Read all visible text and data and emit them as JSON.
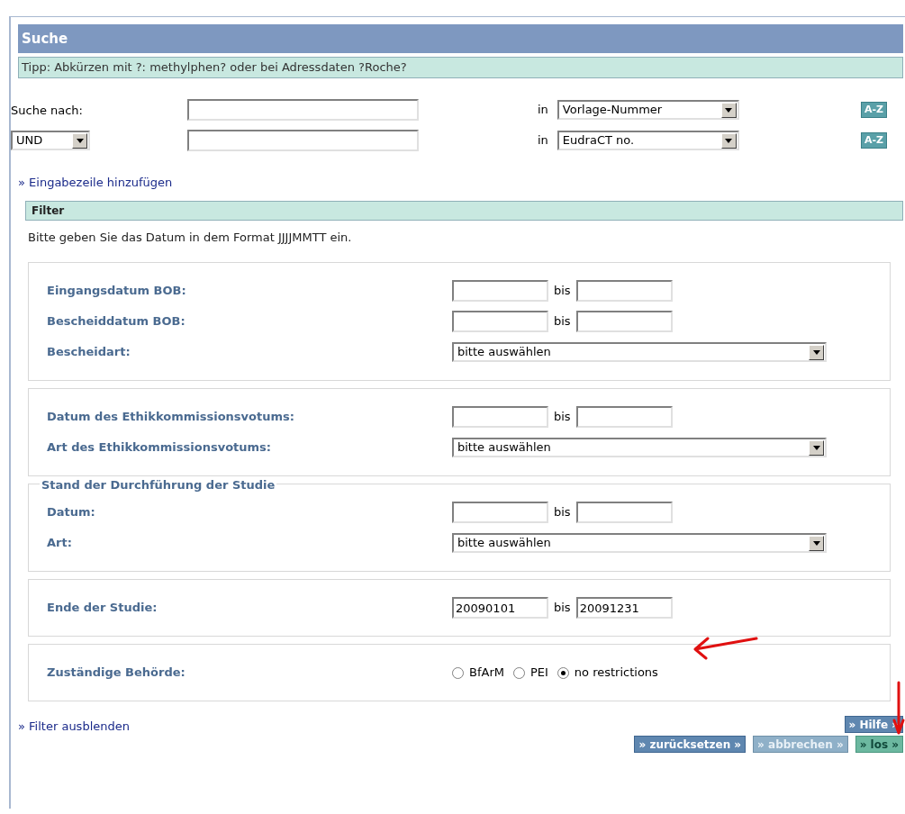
{
  "title": "Suche",
  "tip": "Tipp: Abkürzen mit ?: methylphen? oder bei Adressdaten ?Roche?",
  "search_rows": [
    {
      "kind": "label",
      "label": "Suche nach:",
      "value": "",
      "in": "in",
      "field": "Vorlage-Nummer",
      "az": "A-Z"
    },
    {
      "kind": "operator",
      "label": "UND",
      "value": "",
      "in": "in",
      "field": "EudraCT no.",
      "az": "A-Z"
    }
  ],
  "add_row_link": "» Eingabezeile hinzufügen",
  "filter": {
    "title": "Filter",
    "hint": "Bitte geben Sie das Datum in dem Format JJJJMMTT ein.",
    "groups": [
      {
        "rows": [
          {
            "kind": "range",
            "label": "Eingangsdatum BOB:",
            "from": "",
            "bis": "bis",
            "to": ""
          },
          {
            "kind": "range",
            "label": "Bescheiddatum BOB:",
            "from": "",
            "bis": "bis",
            "to": ""
          },
          {
            "kind": "select",
            "label": "Bescheidart:",
            "value": "bitte auswählen"
          }
        ]
      },
      {
        "rows": [
          {
            "kind": "range",
            "label": "Datum des Ethikkommissionsvotums:",
            "from": "",
            "bis": "bis",
            "to": ""
          },
          {
            "kind": "select",
            "label": "Art des Ethikkommissionsvotums:",
            "value": "bitte auswählen"
          }
        ]
      },
      {
        "legend": "Stand der Durchführung der Studie",
        "rows": [
          {
            "kind": "range",
            "label": "Datum:",
            "from": "",
            "bis": "bis",
            "to": ""
          },
          {
            "kind": "select",
            "label": "Art:",
            "value": "bitte auswählen"
          }
        ]
      },
      {
        "rows": [
          {
            "kind": "range",
            "label": "Ende der Studie:",
            "from": "20090101",
            "bis": "bis",
            "to": "20091231"
          }
        ]
      },
      {
        "rows": [
          {
            "kind": "radio",
            "label": "Zuständige Behörde:",
            "options": [
              {
                "label": "BfArM",
                "selected": false
              },
              {
                "label": "PEI",
                "selected": false
              },
              {
                "label": "no restrictions",
                "selected": true
              }
            ]
          }
        ]
      }
    ]
  },
  "hide_filter_link": "» Filter ausblenden",
  "buttons": [
    {
      "kind": "help",
      "label": "» Hilfe »"
    },
    {
      "kind": "reset",
      "label": "» zurücksetzen »"
    },
    {
      "kind": "cancel",
      "label": "» abbrechen »"
    },
    {
      "kind": "go",
      "label": "» los »"
    }
  ]
}
